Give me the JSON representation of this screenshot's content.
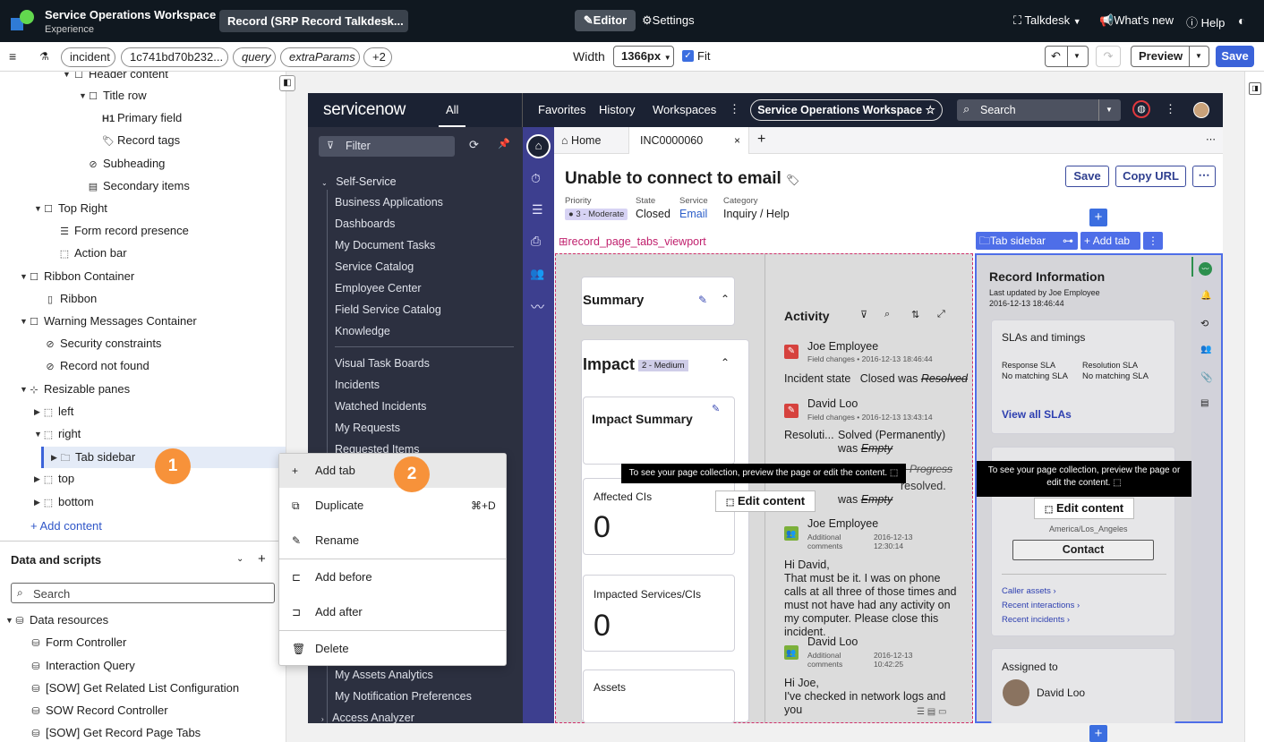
{
  "topbar": {
    "app_title": "Service Operations Workspace",
    "app_subtitle": "Experience",
    "record_selector": "Record (SRP Record Talkdesk...",
    "editor_tab": "Editor",
    "settings_tab": "Settings",
    "talkdesk_menu": "Talkdesk",
    "whats_new": "What's new",
    "help": "Help"
  },
  "toolbar": {
    "params": [
      "incident",
      "1c741bd70b232...",
      "query",
      "extraParams",
      "+2"
    ],
    "width_label": "Width",
    "width_value": "1366px",
    "fit_label": "Fit",
    "fit_checked": true,
    "preview_label": "Preview",
    "save_label": "Save"
  },
  "tree": {
    "items": [
      {
        "label": "Header content"
      },
      {
        "label": "Title row"
      },
      {
        "label": "Primary field"
      },
      {
        "label": "Record tags"
      },
      {
        "label": "Subheading"
      },
      {
        "label": "Secondary items"
      },
      {
        "label": "Top Right"
      },
      {
        "label": "Form record presence"
      },
      {
        "label": "Action bar"
      },
      {
        "label": "Ribbon Container"
      },
      {
        "label": "Ribbon"
      },
      {
        "label": "Warning Messages Container"
      },
      {
        "label": "Security constraints"
      },
      {
        "label": "Record not found"
      },
      {
        "label": "Resizable panes"
      },
      {
        "label": "left"
      },
      {
        "label": "right"
      },
      {
        "label": "Tab sidebar"
      },
      {
        "label": "top"
      },
      {
        "label": "bottom"
      }
    ],
    "add_content": "Add content"
  },
  "data_scripts": {
    "title": "Data and scripts",
    "search_placeholder": "Search",
    "section": "Data resources",
    "items": [
      "Form Controller",
      "Interaction Query",
      "[SOW] Get Related List Configuration",
      "SOW Record Controller",
      "[SOW] Get Record Page Tabs"
    ]
  },
  "badges": {
    "one": "1",
    "two": "2"
  },
  "context_menu": {
    "items": [
      {
        "label": "Add tab",
        "shortcut": ""
      },
      {
        "label": "Duplicate",
        "shortcut": "⌘+D"
      },
      {
        "label": "Rename",
        "shortcut": ""
      },
      {
        "label": "Add before",
        "shortcut": ""
      },
      {
        "label": "Add after",
        "shortcut": ""
      },
      {
        "label": "Delete",
        "shortcut": ""
      }
    ]
  },
  "sn": {
    "logo": "servicenow",
    "all_tab": "All",
    "nav_links": [
      "Favorites",
      "History",
      "Workspaces"
    ],
    "workspace_pill": "Service Operations Workspace",
    "search_placeholder": "Search",
    "filter_placeholder": "Filter",
    "nav_section": "Self-Service",
    "nav_items": [
      "Business Applications",
      "Dashboards",
      "My Document Tasks",
      "Service Catalog",
      "Employee Center",
      "Field Service Catalog",
      "Knowledge",
      "Visual Task Boards",
      "Incidents",
      "Watched Incidents",
      "My Requests",
      "Requested Items",
      "My Assets Analytics",
      "My Notification Preferences",
      "Access Analyzer"
    ],
    "tabs": {
      "home": "Home",
      "record": "INC0000060"
    },
    "record": {
      "title": "Unable to connect to email",
      "save": "Save",
      "copy_url": "Copy URL",
      "fields": [
        {
          "label": "Priority",
          "value": "3 - Moderate"
        },
        {
          "label": "State",
          "value": "Closed"
        },
        {
          "label": "Service",
          "value": "Email"
        },
        {
          "label": "Category",
          "value": "Inquiry / Help"
        }
      ]
    },
    "viewport_label": "record_page_tabs_viewport",
    "tab_sidebar_chip": "Tab sidebar",
    "add_tab_chip": "Add tab",
    "summary": "Summary",
    "impact": "Impact",
    "impact_level": "2 - Medium",
    "impact_summary": "Impact Summary",
    "affected_cis": "Affected CIs",
    "affected_count": "0",
    "impacted_services": "Impacted Services/CIs",
    "impacted_count": "0",
    "assets": "Assets",
    "activity": {
      "title": "Activity",
      "entries": [
        {
          "author": "Joe Employee",
          "type": "Field changes",
          "time": "2016-12-13 18:46:44"
        },
        {
          "author": "David Loo",
          "type": "Field changes",
          "time": "2016-12-13 13:43:14"
        },
        {
          "author": "Joe Employee",
          "type": "Additional comments",
          "time": "2016-12-13 12:30:14"
        },
        {
          "author": "David Loo",
          "type": "Additional comments",
          "time": "2016-12-13 10:42:25"
        }
      ],
      "state_line_label": "Incident state",
      "state_line_value": "Closed was",
      "state_line_old": "Resolved",
      "resolution_label": "Resoluti...",
      "resolution_value": "Solved (Permanently)",
      "resolution_was": "was",
      "resolution_old": "Empty",
      "ghost_progress": "n Progress",
      "ghost_resolved": "resolved.",
      "ghost_was": "was",
      "ghost_empty": "Empty",
      "comment1": "Hi David,\nThat must be it. I was on phone calls at all three of those times and must not have had any activity on my computer. Please close this incident.",
      "comment2": "Hi Joe,\nI've checked in network logs and you"
    },
    "tooltip": "To see your page collection, preview the page or edit the content.",
    "edit_content": "Edit content",
    "record_info": {
      "title": "Record Information",
      "updated_by": "Last updated by Joe Employee",
      "updated_at": "2016-12-13 18:46:44",
      "sla_title": "SLAs and timings",
      "response_sla": "Response SLA",
      "resolution_sla": "Resolution SLA",
      "no_match": "No matching SLA",
      "view_all": "View all SLAs",
      "location": "America/Los_Angeles",
      "contact": "Contact",
      "links": [
        "Caller assets",
        "Recent interactions",
        "Recent incidents"
      ],
      "assigned_to": "Assigned to",
      "assignee": "David Loo"
    }
  },
  "colors": {
    "topbar": "#101820",
    "accent": "#3b63d9",
    "badge": "#f7923a",
    "sn_nav": "#2c3040",
    "sn_rail": "#3d3f8f"
  }
}
